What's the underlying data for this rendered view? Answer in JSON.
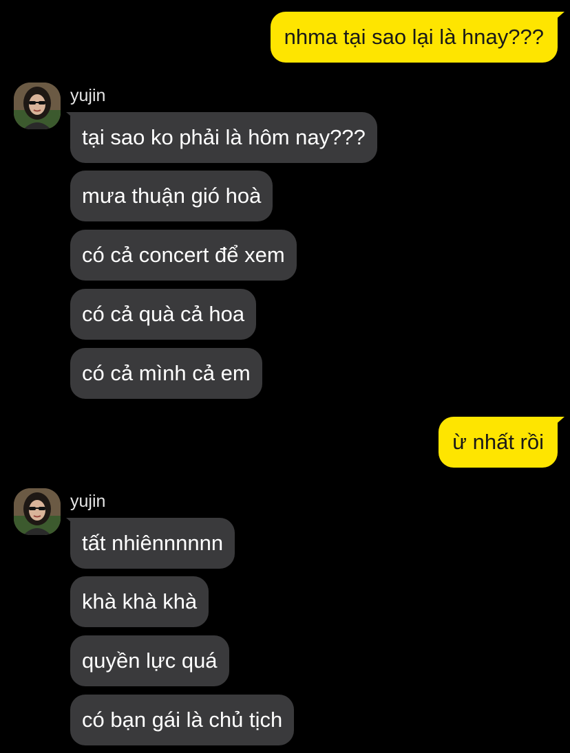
{
  "conversation": {
    "messages": [
      {
        "from": "me",
        "text": "nhma tại sao lại là hnay???"
      },
      {
        "from": "yujin",
        "text": "tại sao ko phải là hôm nay???"
      },
      {
        "from": "yujin",
        "text": "mưa thuận gió hoà"
      },
      {
        "from": "yujin",
        "text": "có cả concert để xem"
      },
      {
        "from": "yujin",
        "text": "có cả quà cả hoa"
      },
      {
        "from": "yujin",
        "text": "có cả mình cả em"
      },
      {
        "from": "me",
        "text": "ừ nhất rồi"
      },
      {
        "from": "yujin",
        "text": "tất nhiênnnnnn"
      },
      {
        "from": "yujin",
        "text": "khà khà khà"
      },
      {
        "from": "yujin",
        "text": "quyền lực quá"
      },
      {
        "from": "yujin",
        "text": "có bạn gái là chủ tịch"
      }
    ],
    "groups": [
      {
        "sender_name": "yujin"
      },
      {
        "sender_name": "yujin"
      }
    ]
  },
  "colors": {
    "background": "#000000",
    "outgoing_bubble": "#fee500",
    "outgoing_text": "#191919",
    "incoming_bubble": "#3a3a3c",
    "incoming_text": "#ffffff"
  }
}
